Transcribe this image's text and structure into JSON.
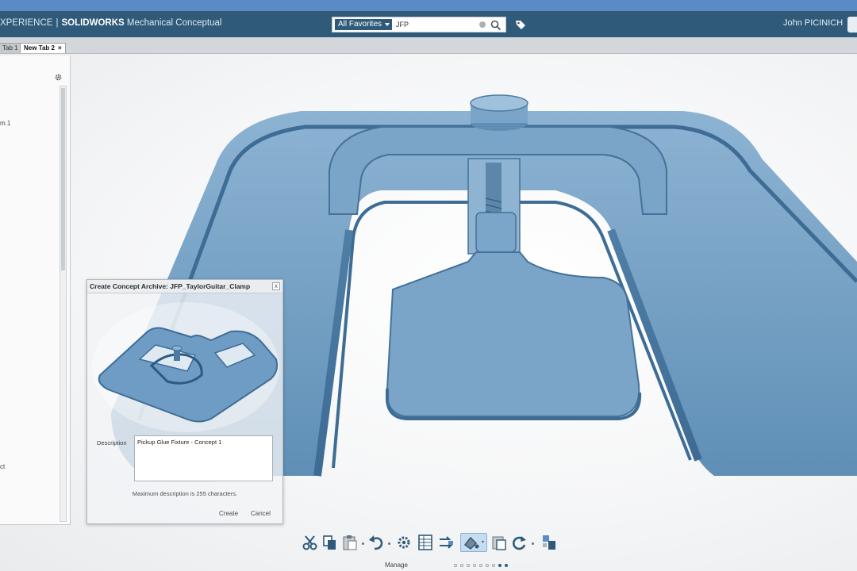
{
  "header": {
    "brand_prefix": "XPERIENCE",
    "separator": "|",
    "brand_name": "SOLIDWORKS",
    "app_name": "Mechanical Conceptual",
    "user_name": "John PICINICH"
  },
  "search": {
    "scope": "All Favorites",
    "query": "JFP"
  },
  "tabs": [
    {
      "label": "Tab 1"
    },
    {
      "label": "New Tab 2",
      "close": "×"
    }
  ],
  "left_panel": {
    "fragment_1": "m.1",
    "fragment_2": "ct"
  },
  "dialog": {
    "title": "Create Concept Archive: JFP_TaylorGuitar_Clamp",
    "close": "x",
    "description_label": "Description",
    "description_value": "Pickup Glue Fixture - Concept 1",
    "hint": "Maximum description is 255 characters.",
    "create_label": "Create",
    "cancel_label": "Cancel"
  },
  "toolbar": {
    "section_label": "Manage",
    "tools": [
      "cut-icon",
      "copy-icon",
      "paste-icon",
      "undo-icon",
      "settings-icon",
      "table-icon",
      "swap-icon",
      "paint-icon",
      "clipboard-icon",
      "refresh-icon",
      "arrange-icon"
    ],
    "pager_count": 9,
    "pager_active": [
      7,
      8
    ]
  },
  "colors": {
    "header_bg": "#2f5a79",
    "accent": "#5a8bc4",
    "model_blue": "#6f9bbf"
  }
}
